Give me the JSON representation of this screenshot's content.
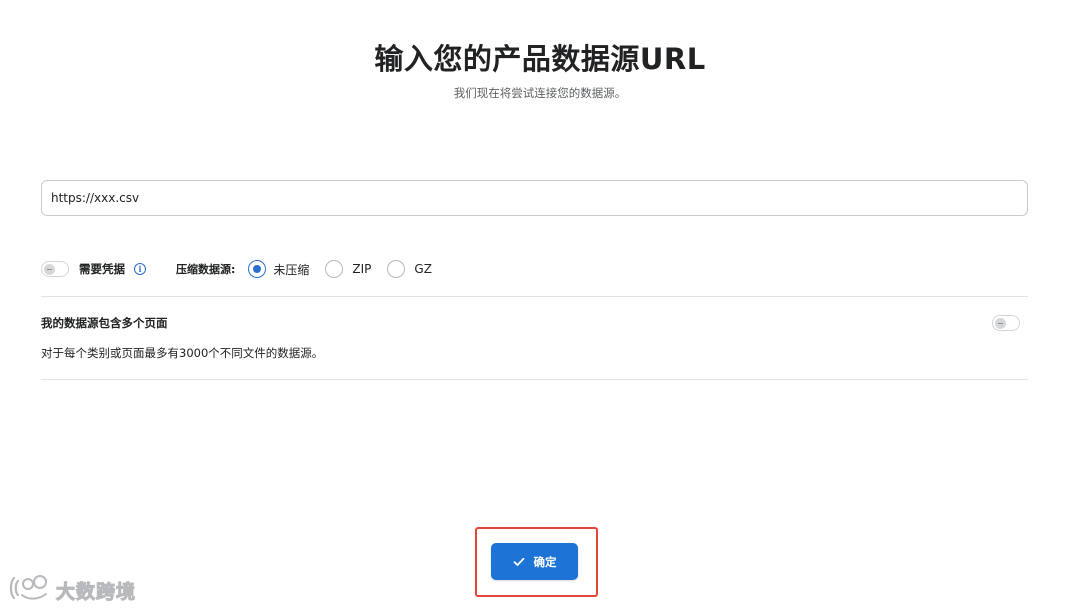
{
  "header": {
    "title": "输入您的产品数据源URL",
    "subtitle": "我们现在将尝试连接您的数据源。"
  },
  "url_field": {
    "value": "https://xxx.csv",
    "placeholder": ""
  },
  "options": {
    "credentials_label": "需要凭据",
    "credentials_enabled": false,
    "compression_label": "压缩数据源:",
    "compression_options": [
      "未压缩",
      "ZIP",
      "GZ"
    ],
    "compression_selected": "未压缩"
  },
  "multi_page": {
    "title": "我的数据源包含多个页面",
    "description": "对于每个类别或页面最多有3000个不同文件的数据源。",
    "enabled": false
  },
  "footer": {
    "confirm_label": "确定"
  },
  "watermark": {
    "text": "大数跨境"
  },
  "colors": {
    "primary": "#1d74d6",
    "highlight_border": "#e5463a",
    "info": "#2c6ecb"
  }
}
